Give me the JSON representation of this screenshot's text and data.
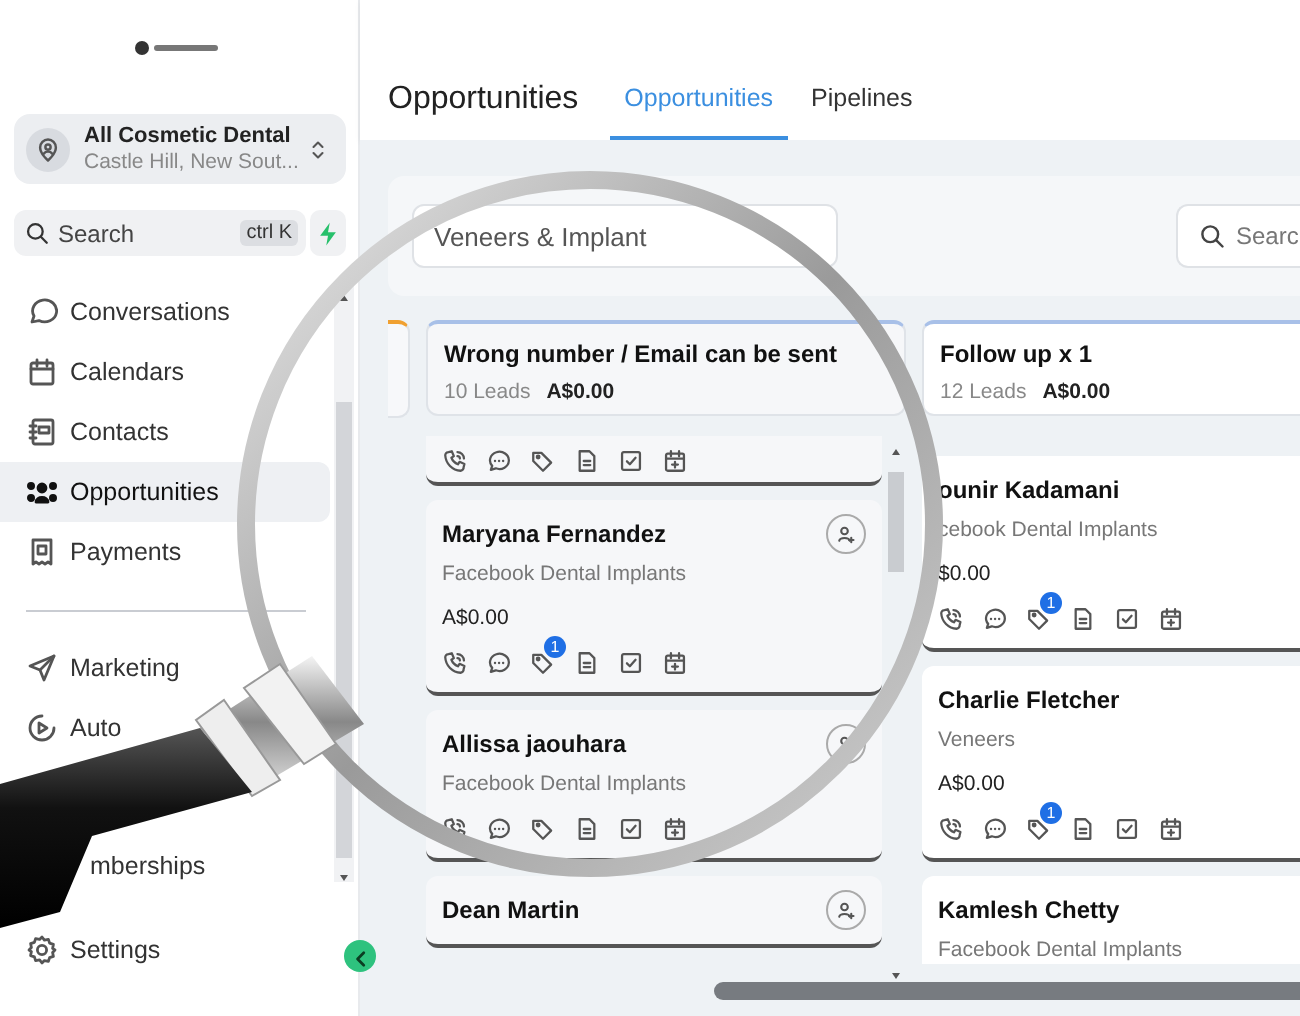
{
  "location": {
    "name": "All Cosmetic Dental",
    "address": "Castle Hill, New Sout..."
  },
  "search": {
    "placeholder": "Search",
    "shortcut": "ctrl K"
  },
  "nav": [
    {
      "label": "Conversations",
      "selected": false
    },
    {
      "label": "Calendars",
      "selected": false
    },
    {
      "label": "Contacts",
      "selected": false
    },
    {
      "label": "Opportunities",
      "selected": true
    },
    {
      "label": "Payments",
      "selected": false
    }
  ],
  "nav_lower": [
    {
      "label": "Marketing"
    },
    {
      "label": "Auto"
    }
  ],
  "nav_bottom": [
    {
      "label": "mberships"
    }
  ],
  "settings": {
    "label": "Settings"
  },
  "header": {
    "title": "Opportunities"
  },
  "tabs": [
    {
      "label": "Opportunities",
      "selected": true
    },
    {
      "label": "Pipelines",
      "selected": false
    }
  ],
  "filter": {
    "pipeline": "Veneers & Implant",
    "search_placeholder": "Searc"
  },
  "columns": [
    {
      "title": "Wrong number / Email can be sent",
      "leads": "10 Leads",
      "amount": "A$0.00",
      "cards": [
        {
          "kind": "icons_only"
        },
        {
          "kind": "full",
          "name": "Maryana Fernandez",
          "source": "Facebook Dental Implants",
          "amount": "A$0.00",
          "badge": "1",
          "assign": true
        },
        {
          "kind": "full",
          "name": "Allissa jaouhara",
          "source": "Facebook Dental Implants",
          "assign": true
        },
        {
          "kind": "full",
          "name": "Dean Martin",
          "assign": true
        }
      ]
    },
    {
      "title": "Follow up x 1",
      "leads": "12 Leads",
      "amount": "A$0.00",
      "cards": [
        {
          "kind": "full",
          "name": "ounir Kadamani",
          "source": "cebook Dental Implants",
          "amount": "$0.00",
          "badge": "1",
          "assign": false
        },
        {
          "kind": "full",
          "name": "Charlie Fletcher",
          "source": "Veneers",
          "amount": "A$0.00",
          "badge": "1",
          "assign": false
        },
        {
          "kind": "full",
          "name": "Kamlesh Chetty",
          "source": "Facebook Dental Implants",
          "assign": false
        }
      ]
    }
  ]
}
